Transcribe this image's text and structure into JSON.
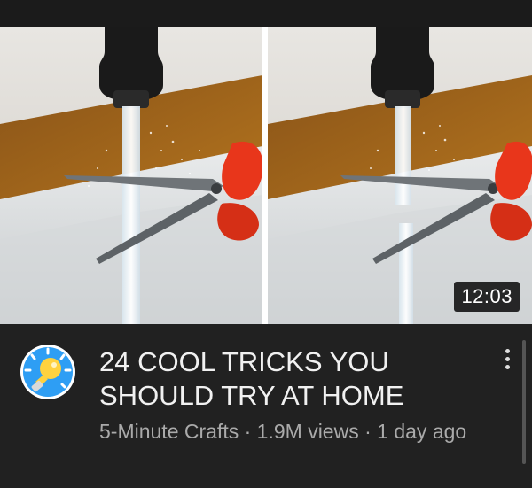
{
  "video": {
    "duration": "12:03",
    "title": "24 COOL TRICKS YOU SHOULD TRY AT HOME",
    "channel": "5-Minute Crafts",
    "views": "1.9M views",
    "age": "1 day ago",
    "separator": " · "
  },
  "icons": {
    "avatar": "lightbulb-icon",
    "menu": "more-vert-icon"
  },
  "colors": {
    "background": "#212121",
    "avatar_bg": "#2e9ef4",
    "bulb": "#ffd23f",
    "scissors_handle": "#e8361b"
  }
}
